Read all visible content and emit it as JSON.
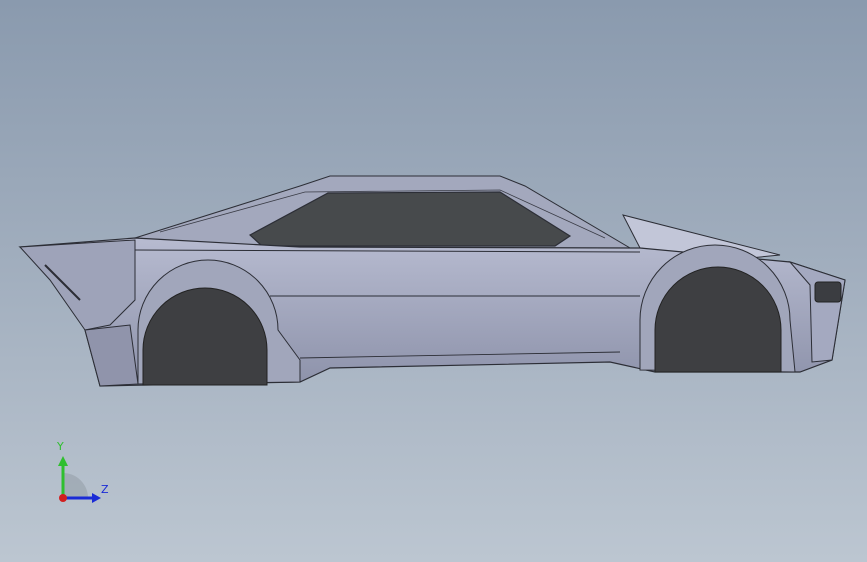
{
  "viewport": {
    "background_top": "#8a9aae",
    "background_bottom": "#bcc6d1",
    "model_color": "#9aa0b8",
    "glass_color": "#474a4c",
    "tire_color": "#3e3f42"
  },
  "triad": {
    "y_label": "Y",
    "z_label": "Z",
    "y_color": "#2fbf2f",
    "z_color": "#1a2bd6",
    "x_color": "#d11f1f"
  }
}
